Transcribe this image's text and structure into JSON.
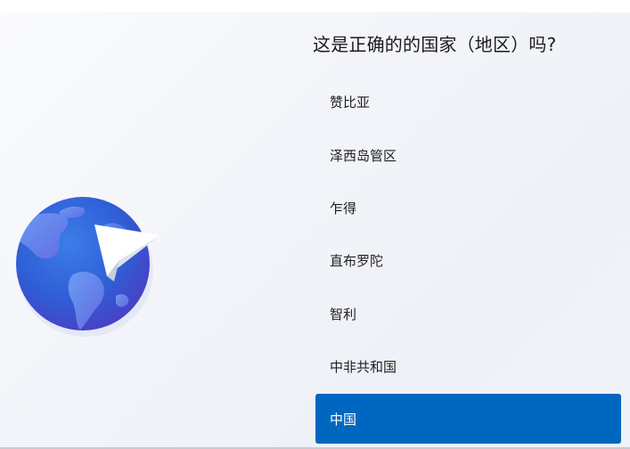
{
  "page": {
    "title": "这是正确的的国家（地区）吗?"
  },
  "country_list": {
    "items": [
      {
        "label": "赞比亚",
        "selected": false
      },
      {
        "label": "泽西岛管区",
        "selected": false
      },
      {
        "label": "乍得",
        "selected": false
      },
      {
        "label": "直布罗陀",
        "selected": false
      },
      {
        "label": "智利",
        "selected": false
      },
      {
        "label": "中非共和国",
        "selected": false
      },
      {
        "label": "中国",
        "selected": true
      }
    ]
  },
  "colors": {
    "accent": "#0067c0",
    "background": "#f2f4f9",
    "text": "#1b1b1b",
    "globe_ocean": "#2f62d8",
    "globe_land": "#5b8ff0"
  },
  "icons": {
    "illustration": "globe-with-paper-plane-icon"
  }
}
